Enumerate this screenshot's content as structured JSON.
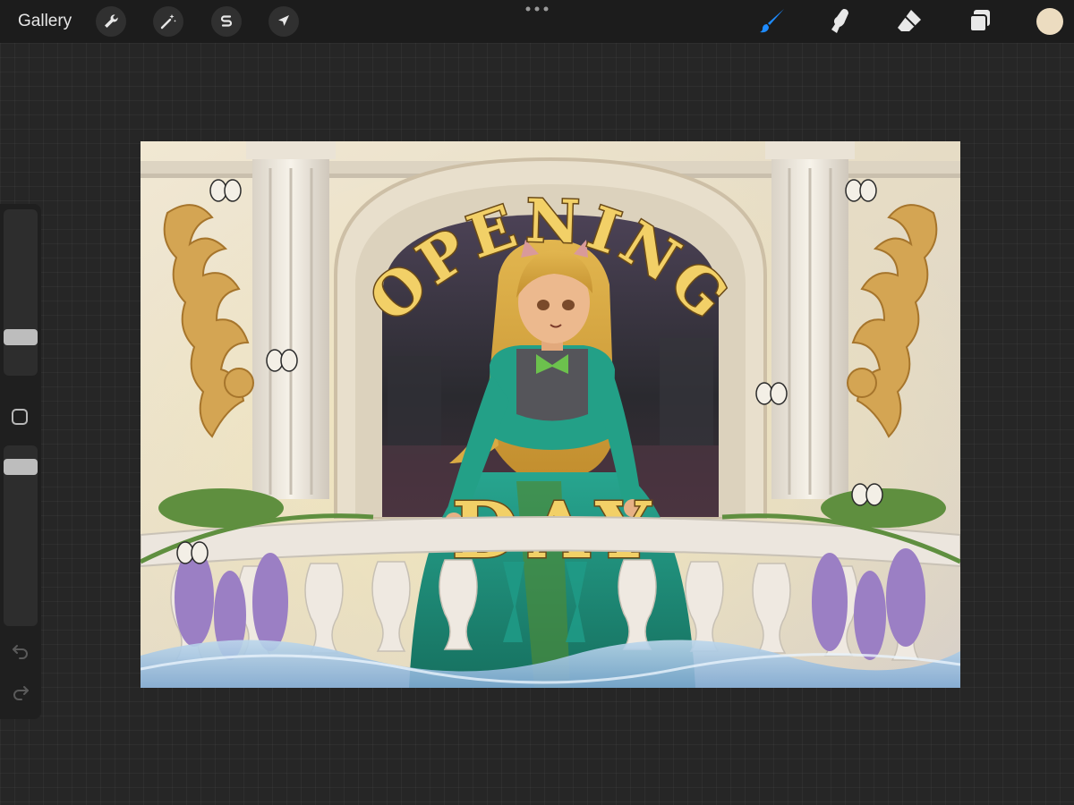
{
  "topbar": {
    "gallery_label": "Gallery",
    "left_tools": [
      {
        "name": "actions",
        "icon": "wrench-icon"
      },
      {
        "name": "adjustments",
        "icon": "magic-wand-icon"
      },
      {
        "name": "selection",
        "icon": "selection-s-icon"
      },
      {
        "name": "transform",
        "icon": "arrow-cursor-icon"
      }
    ],
    "right_tools": [
      {
        "name": "brush",
        "icon": "brush-icon",
        "active": true,
        "color": "#1e8bff"
      },
      {
        "name": "smudge",
        "icon": "smudge-finger-icon"
      },
      {
        "name": "eraser",
        "icon": "eraser-icon"
      },
      {
        "name": "layers",
        "icon": "layers-icon"
      }
    ],
    "current_color": "#ecdcc0"
  },
  "sidebar": {
    "brush_size_level": 0.2,
    "opacity_level": 0.9,
    "icons": [
      "modify-square-icon",
      "undo-icon",
      "redo-icon"
    ]
  },
  "artwork": {
    "title_line1": "OPENING",
    "title_line2": "DAY",
    "colors": {
      "title_gold": "#f2d067",
      "dress_teal": "#1f9a86",
      "wisteria": "#9b7fc4",
      "stone": "#e8dfca"
    }
  }
}
